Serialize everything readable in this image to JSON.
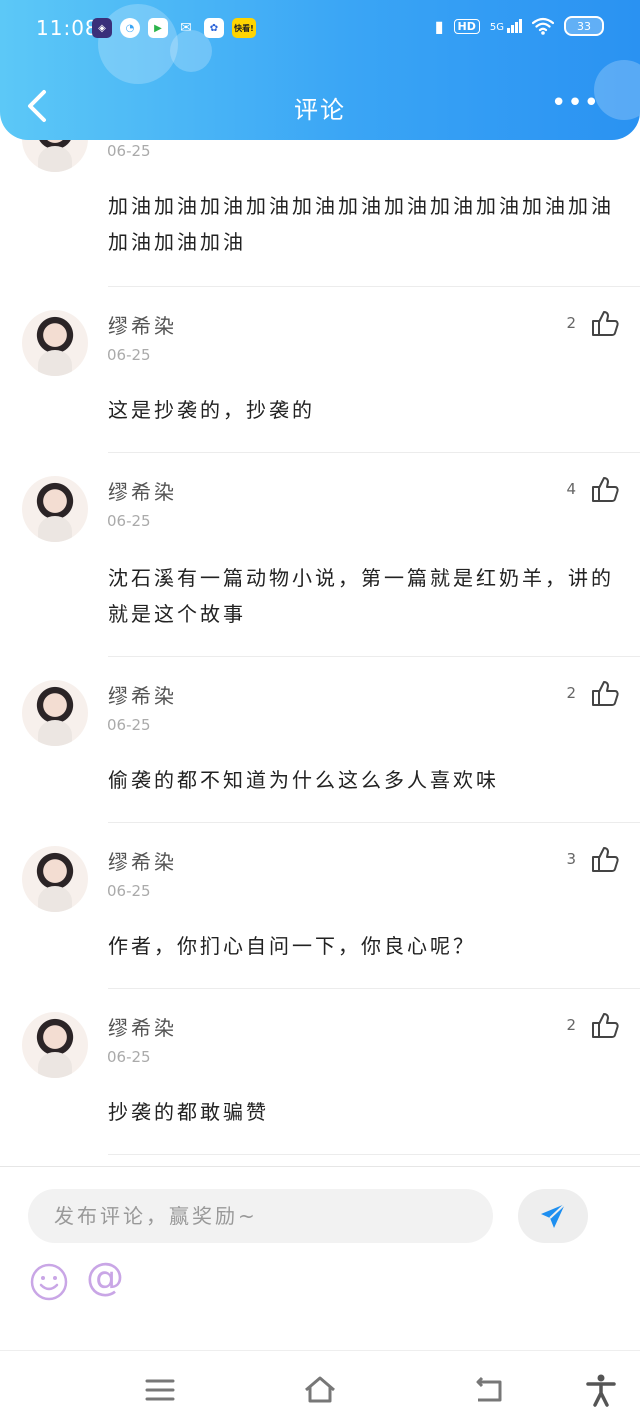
{
  "status_bar": {
    "time": "11:08",
    "network": "5G",
    "hd_label": "HD",
    "battery": "33",
    "app_badge": "快看!"
  },
  "header": {
    "title": "评论",
    "back_icon": "chevron-left-icon",
    "more_icon": "more-dots-icon",
    "more_label": "•••"
  },
  "comments": [
    {
      "username": "",
      "date": "06-25",
      "likes": "",
      "text": "加油加油加油加油加油加油加油加油加油加油加油加油加油加油"
    },
    {
      "username": "缪希染",
      "date": "06-25",
      "likes": "2",
      "text": "这是抄袭的，抄袭的"
    },
    {
      "username": "缪希染",
      "date": "06-25",
      "likes": "4",
      "text": "沈石溪有一篇动物小说，第一篇就是红奶羊，讲的就是这个故事"
    },
    {
      "username": "缪希染",
      "date": "06-25",
      "likes": "2",
      "text": "偷袭的都不知道为什么这么多人喜欢味"
    },
    {
      "username": "缪希染",
      "date": "06-25",
      "likes": "3",
      "text": "作者，你扪心自问一下，你良心呢？"
    },
    {
      "username": "缪希染",
      "date": "06-25",
      "likes": "2",
      "text": "抄袭的都敢骗赞"
    }
  ],
  "input": {
    "placeholder": "发布评论，赢奖励~",
    "at_symbol": "@"
  },
  "colors": {
    "header_start": "#5cc8f7",
    "header_end": "#2a92f2",
    "send_icon": "#1e8ff0",
    "emoji_purple": "#c9a6e6"
  }
}
